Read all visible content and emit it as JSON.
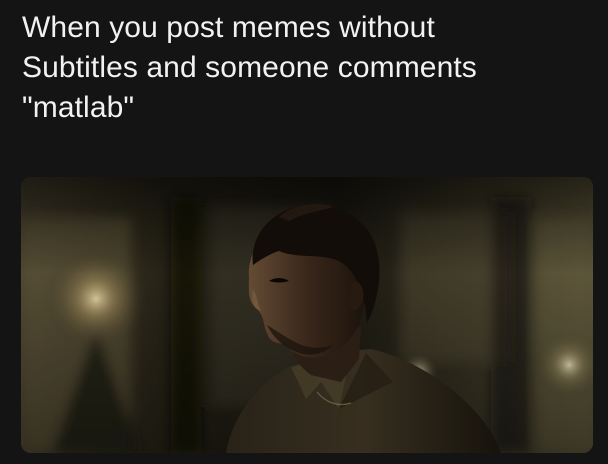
{
  "meme": {
    "caption_lines": [
      "When you post memes without",
      "Subtitles and someone comments",
      "\"matlab\""
    ],
    "image": {
      "icon": "man-in-dim-room-photo",
      "colors": {
        "background": "#141414",
        "text": "#f2f2f2",
        "scene_dark": "#1b1a12",
        "scene_warm": "#c9b98a",
        "skin": "#3a2a1e"
      }
    }
  }
}
